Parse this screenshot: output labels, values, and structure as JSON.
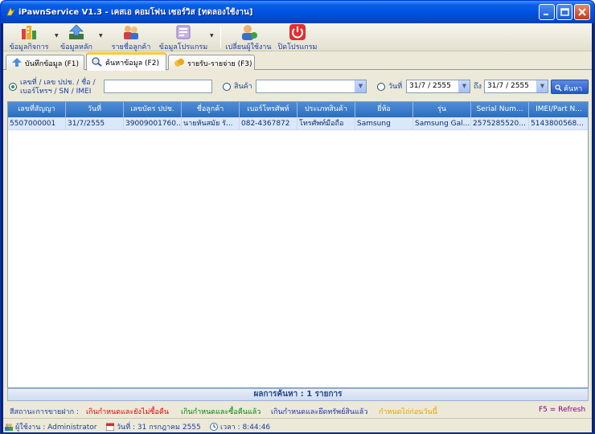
{
  "window": {
    "title": "iPawnService V1.3 - เคสเอ คอมโฟน เซอร์วิส [ทดลองใช้งาน]"
  },
  "toolbar": {
    "items": [
      {
        "label": "ข้อมูลกิจการ"
      },
      {
        "label": "ข้อมูลหลัก"
      },
      {
        "label": "รายชื่อลูกค้า"
      },
      {
        "label": "ข้อมูลโปรแกรม"
      },
      {
        "label": "เปลี่ยนผู้ใช้งาน"
      },
      {
        "label": "ปิดโปรแกรม"
      }
    ]
  },
  "tabs": [
    {
      "label": "บันทึกข้อมูล (F1)"
    },
    {
      "label": "ค้นหาข้อมูล (F2)"
    },
    {
      "label": "รายรับ-รายจ่าย (F3)"
    }
  ],
  "search": {
    "option1_label_line1": "เลขที่ / เลข ปปช. / ชื่อ /",
    "option1_label_line2": "เบอร์โทรฯ / SN / IMEI",
    "text_value": "",
    "option2_label": "สินค้า",
    "product_value": "",
    "option3_label": "วันที่",
    "date_from": "31/7 / 2555",
    "to_label": "ถึง",
    "date_to": "31/7 / 2555",
    "search_button": "ค้นหา"
  },
  "grid": {
    "columns": [
      "เลขที่สัญญา",
      "วันที่",
      "เลขบัตร ปปช.",
      "ชื่อลูกค้า",
      "เบอร์โทรศัพท์",
      "ประเภทสินค้า",
      "ยี่ห้อ",
      "รุ่น",
      "Serial Num...",
      "IMEI/Part N..."
    ],
    "rows": [
      [
        "5507000001",
        "31/7/2555",
        "39009001760...",
        "นายหันสมัย รั...",
        "082-4367872",
        "โทรศัพท์มือถือ",
        "Samsung",
        "Samsung Gal...",
        "2575285520...",
        "5143800568..."
      ]
    ]
  },
  "result": "ผลการค้นหา : 1 รายการ",
  "legend": {
    "title": "สีสถานะการขายฝาก :",
    "item1": "เกินกำหนดและยังไม่ซื้อคืน",
    "item2": "เกินกำหนดและซื้อคืนแล้ว",
    "item3": "เกินกำหนดและยึดทรัพย์สินแล้ว",
    "item4": "กำหนดไถ่ก่อนวันนี้",
    "refresh": "F5 = Refresh",
    "colors": {
      "item1": "#e00000",
      "item2": "#008000",
      "item3": "#1a2fb0",
      "item4": "#e8a000",
      "refresh": "#800080"
    }
  },
  "status": {
    "user": "ผู้ใช้งาน :  Administrator",
    "date": "วันที่ :  31 กรกฎาคม 2555",
    "time": "เวลา :  8:44:46"
  }
}
